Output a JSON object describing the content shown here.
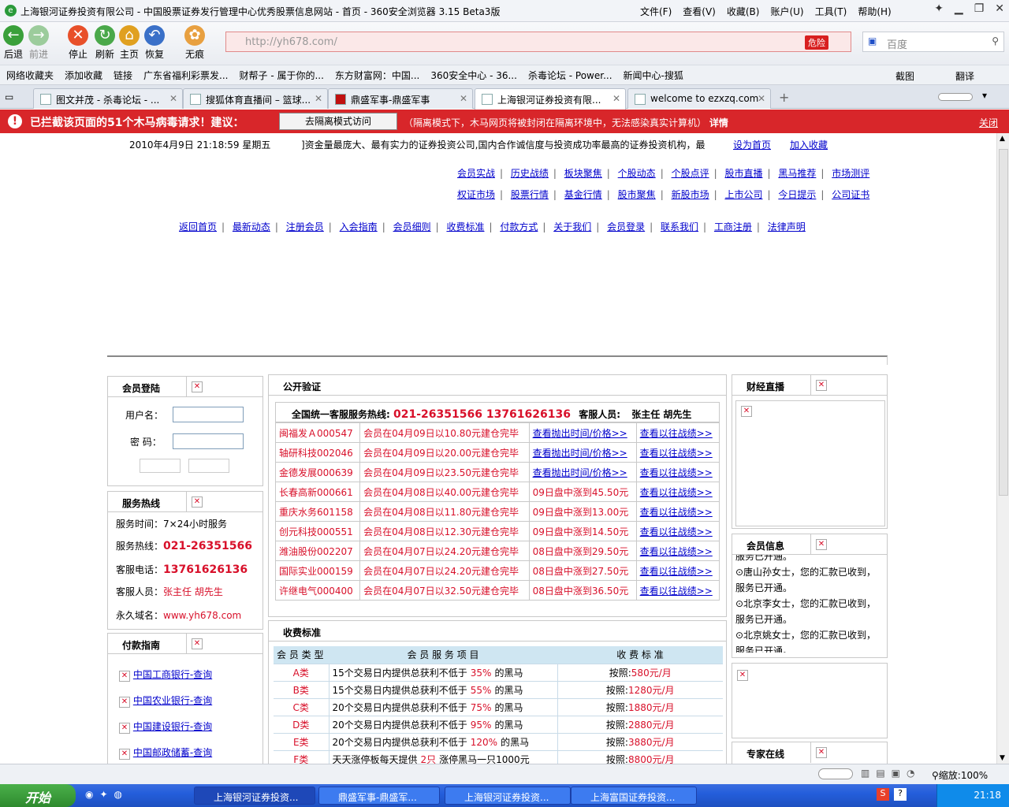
{
  "window": {
    "title": "上海银河证券投资有限公司 - 中国股票证券发行管理中心优秀股票信息网站 - 首页 - 360安全浏览器 3.15 Beta3版",
    "menu": [
      "文件(F)",
      "查看(V)",
      "收藏(B)",
      "账户(U)",
      "工具(T)",
      "帮助(H)"
    ]
  },
  "toolbar": {
    "back": "后退",
    "forward": "前进",
    "stop": "停止",
    "refresh": "刷新",
    "home": "主页",
    "restore": "恢复",
    "incognito": "无痕",
    "address": "http://yh678.com/",
    "danger_label": "危险",
    "search_placeholder": "百度"
  },
  "bookmarks": [
    "网络收藏夹",
    "添加收藏",
    "链接",
    "广东省福利彩票发...",
    "财帮子 - 属于你的...",
    "东方财富网：中国...",
    "360安全中心 - 36...",
    "杀毒论坛 - Power...",
    "新闻中心-搜狐"
  ],
  "bookmarks_right": {
    "screenshot": "截图",
    "translate": "翻译"
  },
  "tabs": [
    {
      "label": "图文并茂 - 杀毒论坛 - ..."
    },
    {
      "label": "搜狐体育直播间 – 篮球..."
    },
    {
      "label": "鼎盛军事-鼎盛军事"
    },
    {
      "label": "上海银河证券投资有限..."
    },
    {
      "label": "welcome to ezxzq.com"
    }
  ],
  "warning": {
    "text": "已拦截该页面的51个木马病毒请求！建议：",
    "button": "去隔离模式访问",
    "note": "（隔离模式下，木马网页将被封闭在隔离环境中，无法感染真实计算机）",
    "detail": "详情",
    "close": "关闭"
  },
  "site": {
    "datetime": "2010年4月9日  21:18:59 星期五",
    "marquee": "]资金量最庞大、最有实力的证券投资公司,国内合作诚信度与投资成功率最高的证券投资机构，最",
    "set_home": "设为首页",
    "add_fav": "加入收藏",
    "nav_row1": [
      "会员实战",
      "历史战绩",
      "板块聚焦",
      "个股动态",
      "个股点评",
      "股市直播",
      "黑马推荐",
      "市场测评"
    ],
    "nav_row2": [
      "权证市场",
      "股票行情",
      "基金行情",
      "股市聚焦",
      "新股市场",
      "上市公司",
      "今日提示",
      "公司证书"
    ],
    "nav_main": [
      "返回首页",
      "最新动态",
      "注册会员",
      "入会指南",
      "会员细则",
      "收费标准",
      "付款方式",
      "关于我们",
      "会员登录",
      "联系我们",
      "工商注册",
      "法律声明"
    ]
  },
  "login": {
    "title": "会员登陆",
    "user_label": "用户名：",
    "pass_label": "密  码："
  },
  "service": {
    "title": "服务热线",
    "hours_label": "服务时间：",
    "hours": "7×24小时服务",
    "hotline_label": "服务热线：",
    "hotline": "021-26351566",
    "phone_label": "客服电话：",
    "phone": "13761626136",
    "staff_label": "客服人员：",
    "staff": "张主任  胡先生",
    "domain_label": "永久域名：",
    "domain": "www.yh678.com"
  },
  "payment": {
    "title": "付款指南",
    "banks": [
      "中国工商银行-查询",
      "中国农业银行-查询",
      "中国建设银行-查询",
      "中国邮政储蓄-查询"
    ]
  },
  "verify": {
    "title": "公开验证",
    "hotline_prefix": "全国统一客服服务热线:",
    "hotline_nums": "021-26351566  13761626136",
    "staff_prefix": "客服人员:",
    "staff": "张主任   胡先生",
    "rows": [
      {
        "stock": "闽福发Ａ000547",
        "desc": "会员在04月09日以10.80元建仓完毕",
        "status": "查看抛出时间/价格>>",
        "link": "查看以往战绩>>"
      },
      {
        "stock": "轴研科技002046",
        "desc": "会员在04月09日以20.00元建仓完毕",
        "status": "查看抛出时间/价格>>",
        "link": "查看以往战绩>>"
      },
      {
        "stock": "金德发展000639",
        "desc": "会员在04月09日以23.50元建仓完毕",
        "status": "查看抛出时间/价格>>",
        "link": "查看以往战绩>>"
      },
      {
        "stock": "长春高新000661",
        "desc": "会员在04月08日以40.00元建仓完毕",
        "status": "09日盘中涨到45.50元",
        "link": "查看以往战绩>>"
      },
      {
        "stock": "重庆水务601158",
        "desc": "会员在04月08日以11.80元建仓完毕",
        "status": "09日盘中涨到13.00元",
        "link": "查看以往战绩>>"
      },
      {
        "stock": "创元科技000551",
        "desc": "会员在04月08日以12.30元建仓完毕",
        "status": "09日盘中涨到14.50元",
        "link": "查看以往战绩>>"
      },
      {
        "stock": "潍油股份002207",
        "desc": "会员在04月07日以24.20元建仓完毕",
        "status": "08日盘中涨到29.50元",
        "link": "查看以往战绩>>"
      },
      {
        "stock": "国际实业000159",
        "desc": "会员在04月07日以24.20元建仓完毕",
        "status": "08日盘中涨到27.50元",
        "link": "查看以往战绩>>"
      },
      {
        "stock": "许继电气000400",
        "desc": "会员在04月07日以32.50元建仓完毕",
        "status": "08日盘中涨到36.50元",
        "link": "查看以往战绩>>"
      }
    ]
  },
  "fees": {
    "title": "收费标准",
    "headers": [
      "会 员 类 型",
      "会 员 服 务 项 目",
      "收 费 标 准"
    ],
    "rows": [
      {
        "type": "A类",
        "pre": "15个交易日内提供总获利不低于",
        "pct": "35%",
        "post": "的黑马",
        "fee_label": "按照:",
        "fee": "580元/月"
      },
      {
        "type": "B类",
        "pre": "15个交易日内提供总获利不低于",
        "pct": "55%",
        "post": "的黑马",
        "fee_label": "按照:",
        "fee": "1280元/月"
      },
      {
        "type": "C类",
        "pre": "20个交易日内提供总获利不低于",
        "pct": "75%",
        "post": "的黑马",
        "fee_label": "按照:",
        "fee": "1880元/月"
      },
      {
        "type": "D类",
        "pre": "20个交易日内提供总获利不低于",
        "pct": "95%",
        "post": "的黑马",
        "fee_label": "按照:",
        "fee": "2880元/月"
      },
      {
        "type": "E类",
        "pre": "20个交易日内提供总获利不低于",
        "pct": "120%",
        "post": "的黑马",
        "fee_label": "按照:",
        "fee": "3880元/月"
      },
      {
        "type": "F类",
        "pre": "天天涨停板每天提供",
        "pct": "2只",
        "post": "涨停黑马一只1000元",
        "fee_label": "按照:",
        "fee": "8800元/月"
      }
    ]
  },
  "right": {
    "finance_title": "财经直播",
    "member_title": "会员信息",
    "member_lines": [
      "服务已开通。",
      "⊙唐山孙女士，您的汇款已收到，",
      "服务已开通。",
      "⊙北京李女士，您的汇款已收到，",
      "服务已开通。",
      "⊙北京姚女士，您的汇款已收到，",
      "服务已开通。"
    ],
    "expert_title": "专家在线"
  },
  "statusbar": {
    "zoom_label": "缩放:",
    "zoom": "100%"
  },
  "taskbar": {
    "start": "开始",
    "tasks": [
      "上海银河证券投资...",
      "鼎盛军事-鼎盛军...",
      "上海银河证券投资...",
      "上海富国证券投资..."
    ],
    "clock": "21:18"
  }
}
